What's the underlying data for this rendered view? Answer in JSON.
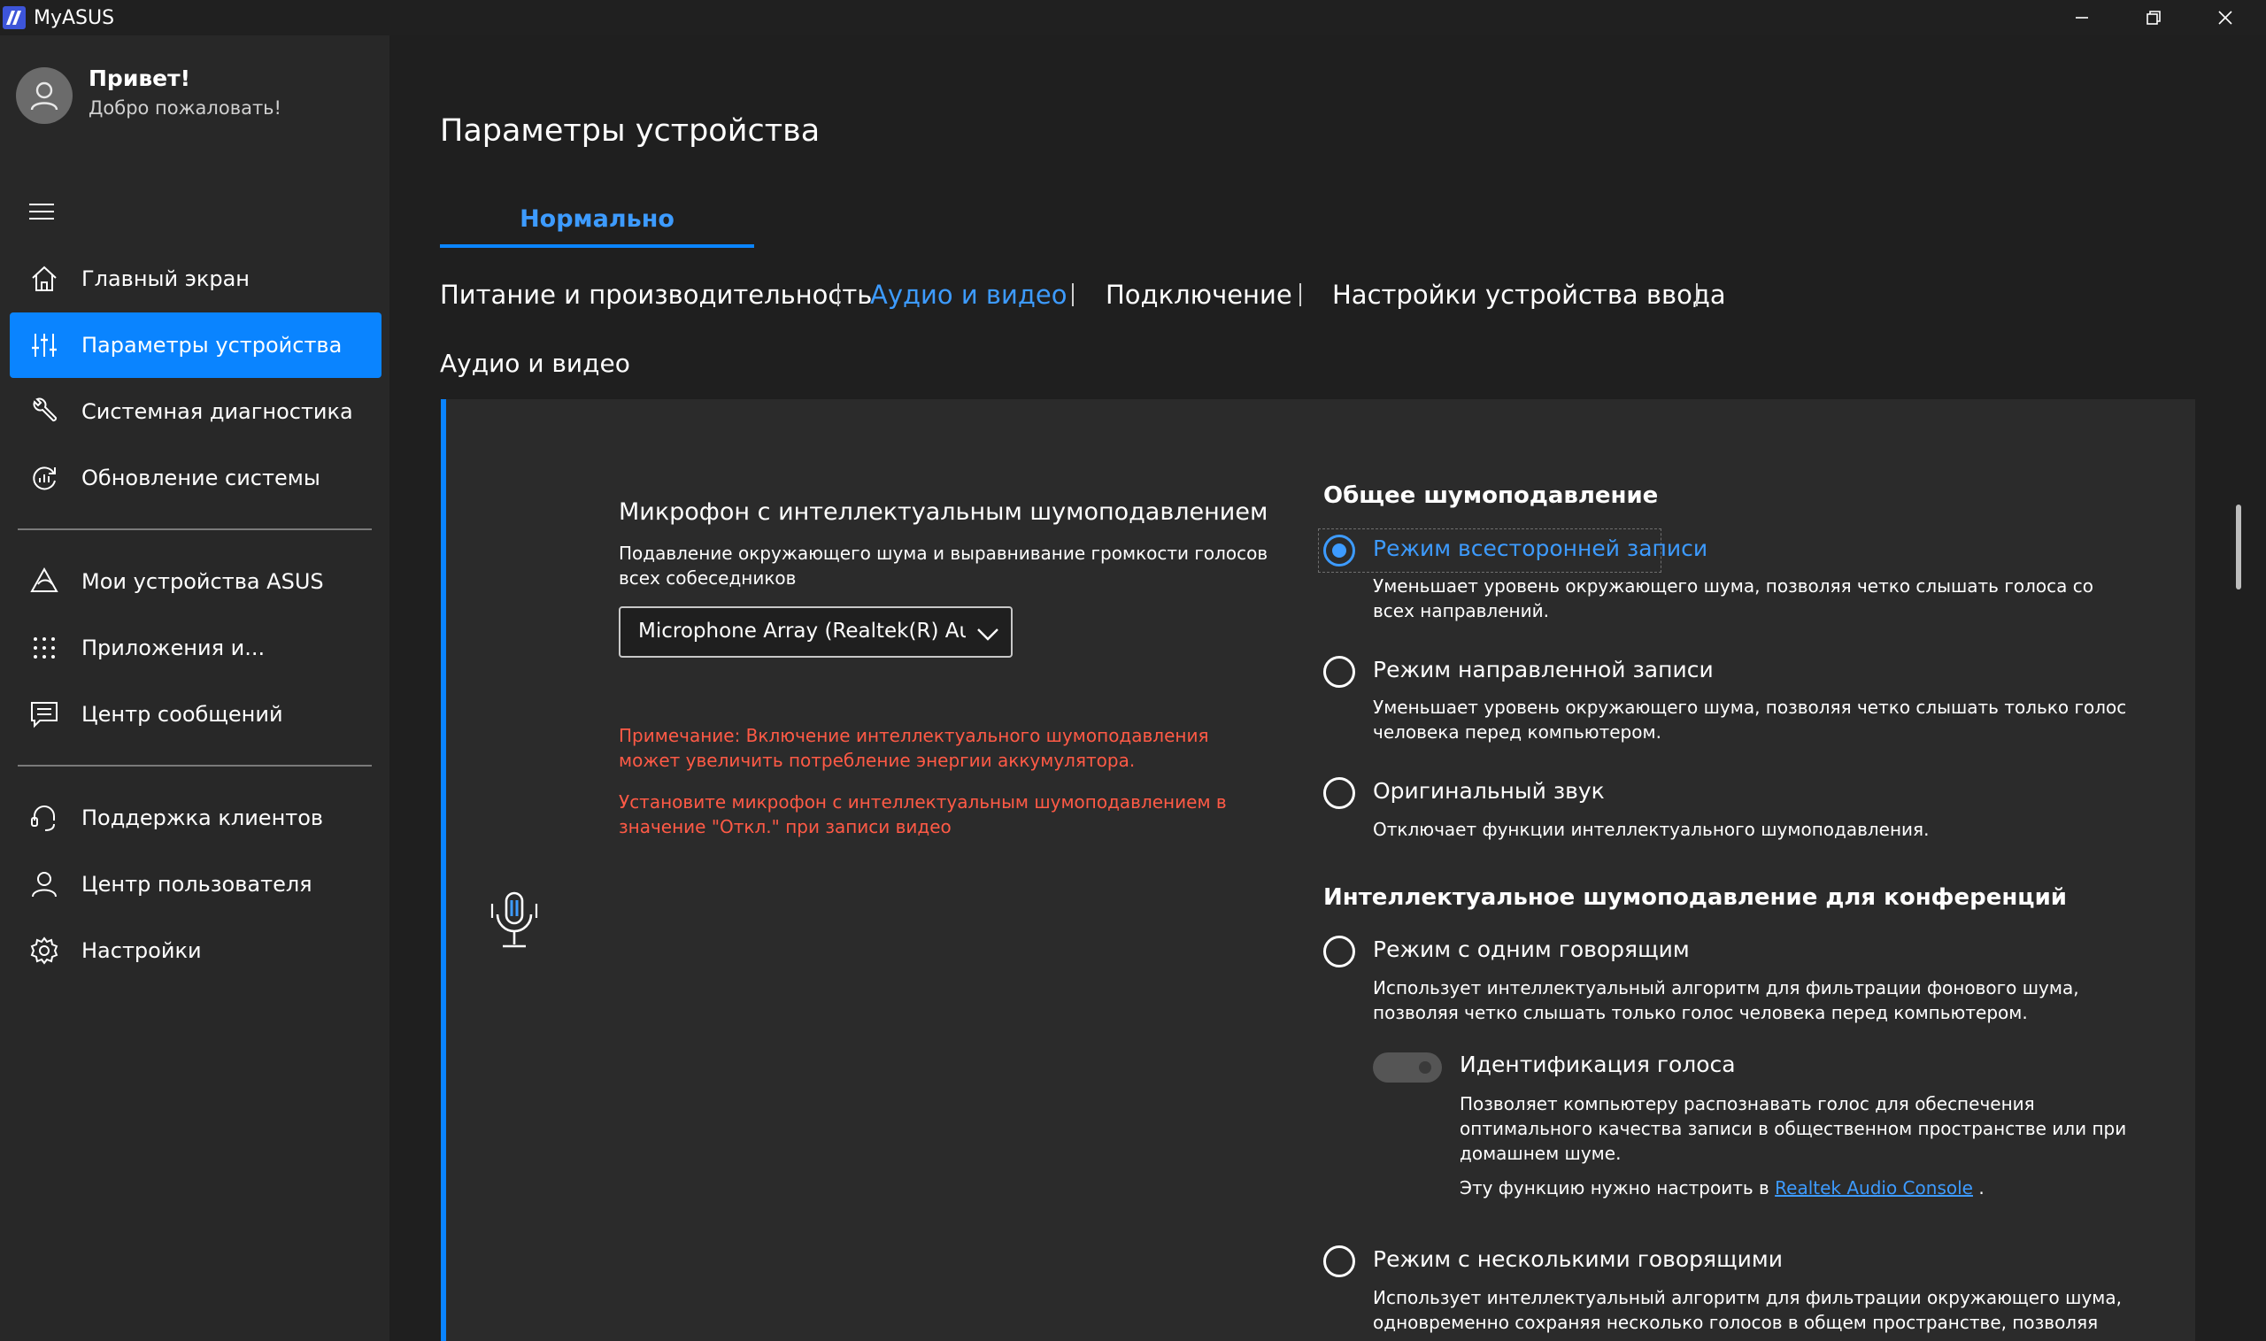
{
  "window": {
    "title": "MyASUS"
  },
  "user": {
    "greeting": "Привет!",
    "welcome": "Добро пожаловать!"
  },
  "sidebar": {
    "items": [
      {
        "label": "Главный экран",
        "icon": "home-icon"
      },
      {
        "label": "Параметры устройства",
        "icon": "sliders-icon",
        "active": true
      },
      {
        "label": "Системная диагностика",
        "icon": "wrench-icon"
      },
      {
        "label": "Обновление системы",
        "icon": "update-icon"
      },
      {
        "label": "Мои устройства ASUS",
        "icon": "asus-devices-icon"
      },
      {
        "label": "Приложения и...",
        "icon": "apps-grid-icon"
      },
      {
        "label": "Центр сообщений",
        "icon": "message-icon"
      },
      {
        "label": "Поддержка клиентов",
        "icon": "headset-icon"
      },
      {
        "label": "Центр пользователя",
        "icon": "user-icon"
      },
      {
        "label": "Настройки",
        "icon": "gear-icon"
      }
    ]
  },
  "main": {
    "title": "Параметры устройства",
    "mode_tab": "Нормально",
    "tabs": [
      "Питание и производительность",
      "Аудио и видео",
      "Подключение",
      "Настройки устройства ввода"
    ],
    "active_tab": "Аудио и видео",
    "section": "Аудио и видео"
  },
  "mic": {
    "title": "Микрофон с интеллектуальным шумоподавлением",
    "description": "Подавление окружающего шума и выравнивание громкости голосов всех собеседников",
    "device": "Microphone Array (Realtek(R) Audio)",
    "warning1": "Примечание: Включение интеллектуального шумоподавления может увеличить потребление энергии аккумулятора.",
    "warning2": "Установите микрофон с интеллектуальным шумоподавлением в значение \"Откл.\" при записи видео"
  },
  "general_nr": {
    "title": "Общее шумоподавление",
    "options": [
      {
        "label": "Режим всесторонней записи",
        "desc": "Уменьшает уровень окружающего шума, позволяя четко слышать голоса со всех направлений.",
        "selected": true
      },
      {
        "label": "Режим направленной записи",
        "desc": "Уменьшает уровень окружающего шума, позволяя четко слышать только голос человека перед компьютером."
      },
      {
        "label": "Оригинальный звук",
        "desc": "Отключает функции интеллектуального шумоподавления."
      }
    ]
  },
  "conference_nr": {
    "title": "Интеллектуальное шумоподавление для конференций",
    "options": [
      {
        "label": "Режим с одним говорящим",
        "desc": "Использует интеллектуальный алгоритм для фильтрации фонового шума, позволяя четко слышать только голос человека перед компьютером."
      },
      {
        "label": "Режим с несколькими говорящими",
        "desc": "Использует интеллектуальный алгоритм для фильтрации окружающего шума, одновременно сохраняя несколько голосов в общем пространстве, позволяя"
      }
    ],
    "voice_id": {
      "label": "Идентификация голоса",
      "desc": "Позволяет компьютеру распознавать голос для обеспечения оптимального качества записи в общественном пространстве или при домашнем шуме.",
      "note_prefix": "Эту функцию нужно настроить в",
      "link": "Realtek Audio Console",
      "note_suffix": ".",
      "enabled": false
    }
  },
  "colors": {
    "accent": "#0a84ff",
    "warning": "#ff5a46",
    "sidebar": "#282828",
    "card": "#2b2b2b"
  }
}
